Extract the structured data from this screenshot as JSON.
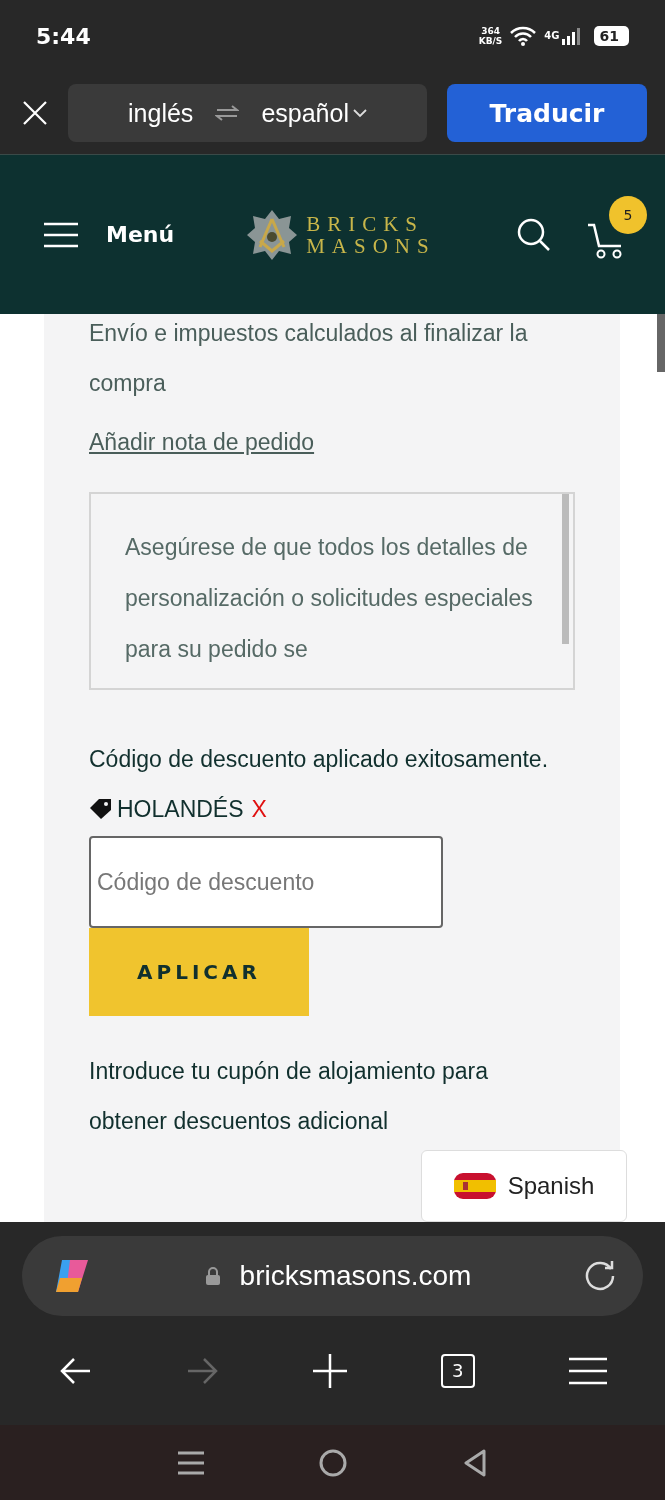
{
  "status_bar": {
    "time": "5:44",
    "speed": "364",
    "speed_unit": "KB/S",
    "network": "4G",
    "battery": "61"
  },
  "translate_bar": {
    "source": "inglés",
    "target": "español",
    "button": "Traducir"
  },
  "header": {
    "menu": "Menú",
    "logo_line1": "BRICKS",
    "logo_line2": "MASONS",
    "cart_count": "5"
  },
  "content": {
    "shipping_note": "Envío e impuestos calculados al finalizar la compra",
    "order_note_link": "Añadir nota de pedido",
    "order_note_placeholder": "Asegúrese de que todos los detalles de personalización o solicitudes especiales para su pedido se",
    "discount_message": "Código de descuento aplicado exitosamente.",
    "applied_code": "HOLANDÉS",
    "remove_code": "X",
    "discount_placeholder": "Código de descuento",
    "apply_button": "APLICAR",
    "coupon_text": "Introduce tu cupón de alojamiento para obtener descuentos adicional"
  },
  "language_badge": {
    "label": "Spanish"
  },
  "browser_bar": {
    "url": "bricksmasons.com",
    "tab_count": "3",
    "nav": [
      {
        "kind": "back",
        "disabled": false
      },
      {
        "kind": "forward",
        "disabled": true
      },
      {
        "kind": "new-tab",
        "disabled": false
      },
      {
        "kind": "tabs",
        "disabled": false
      },
      {
        "kind": "menu",
        "disabled": false
      }
    ]
  }
}
